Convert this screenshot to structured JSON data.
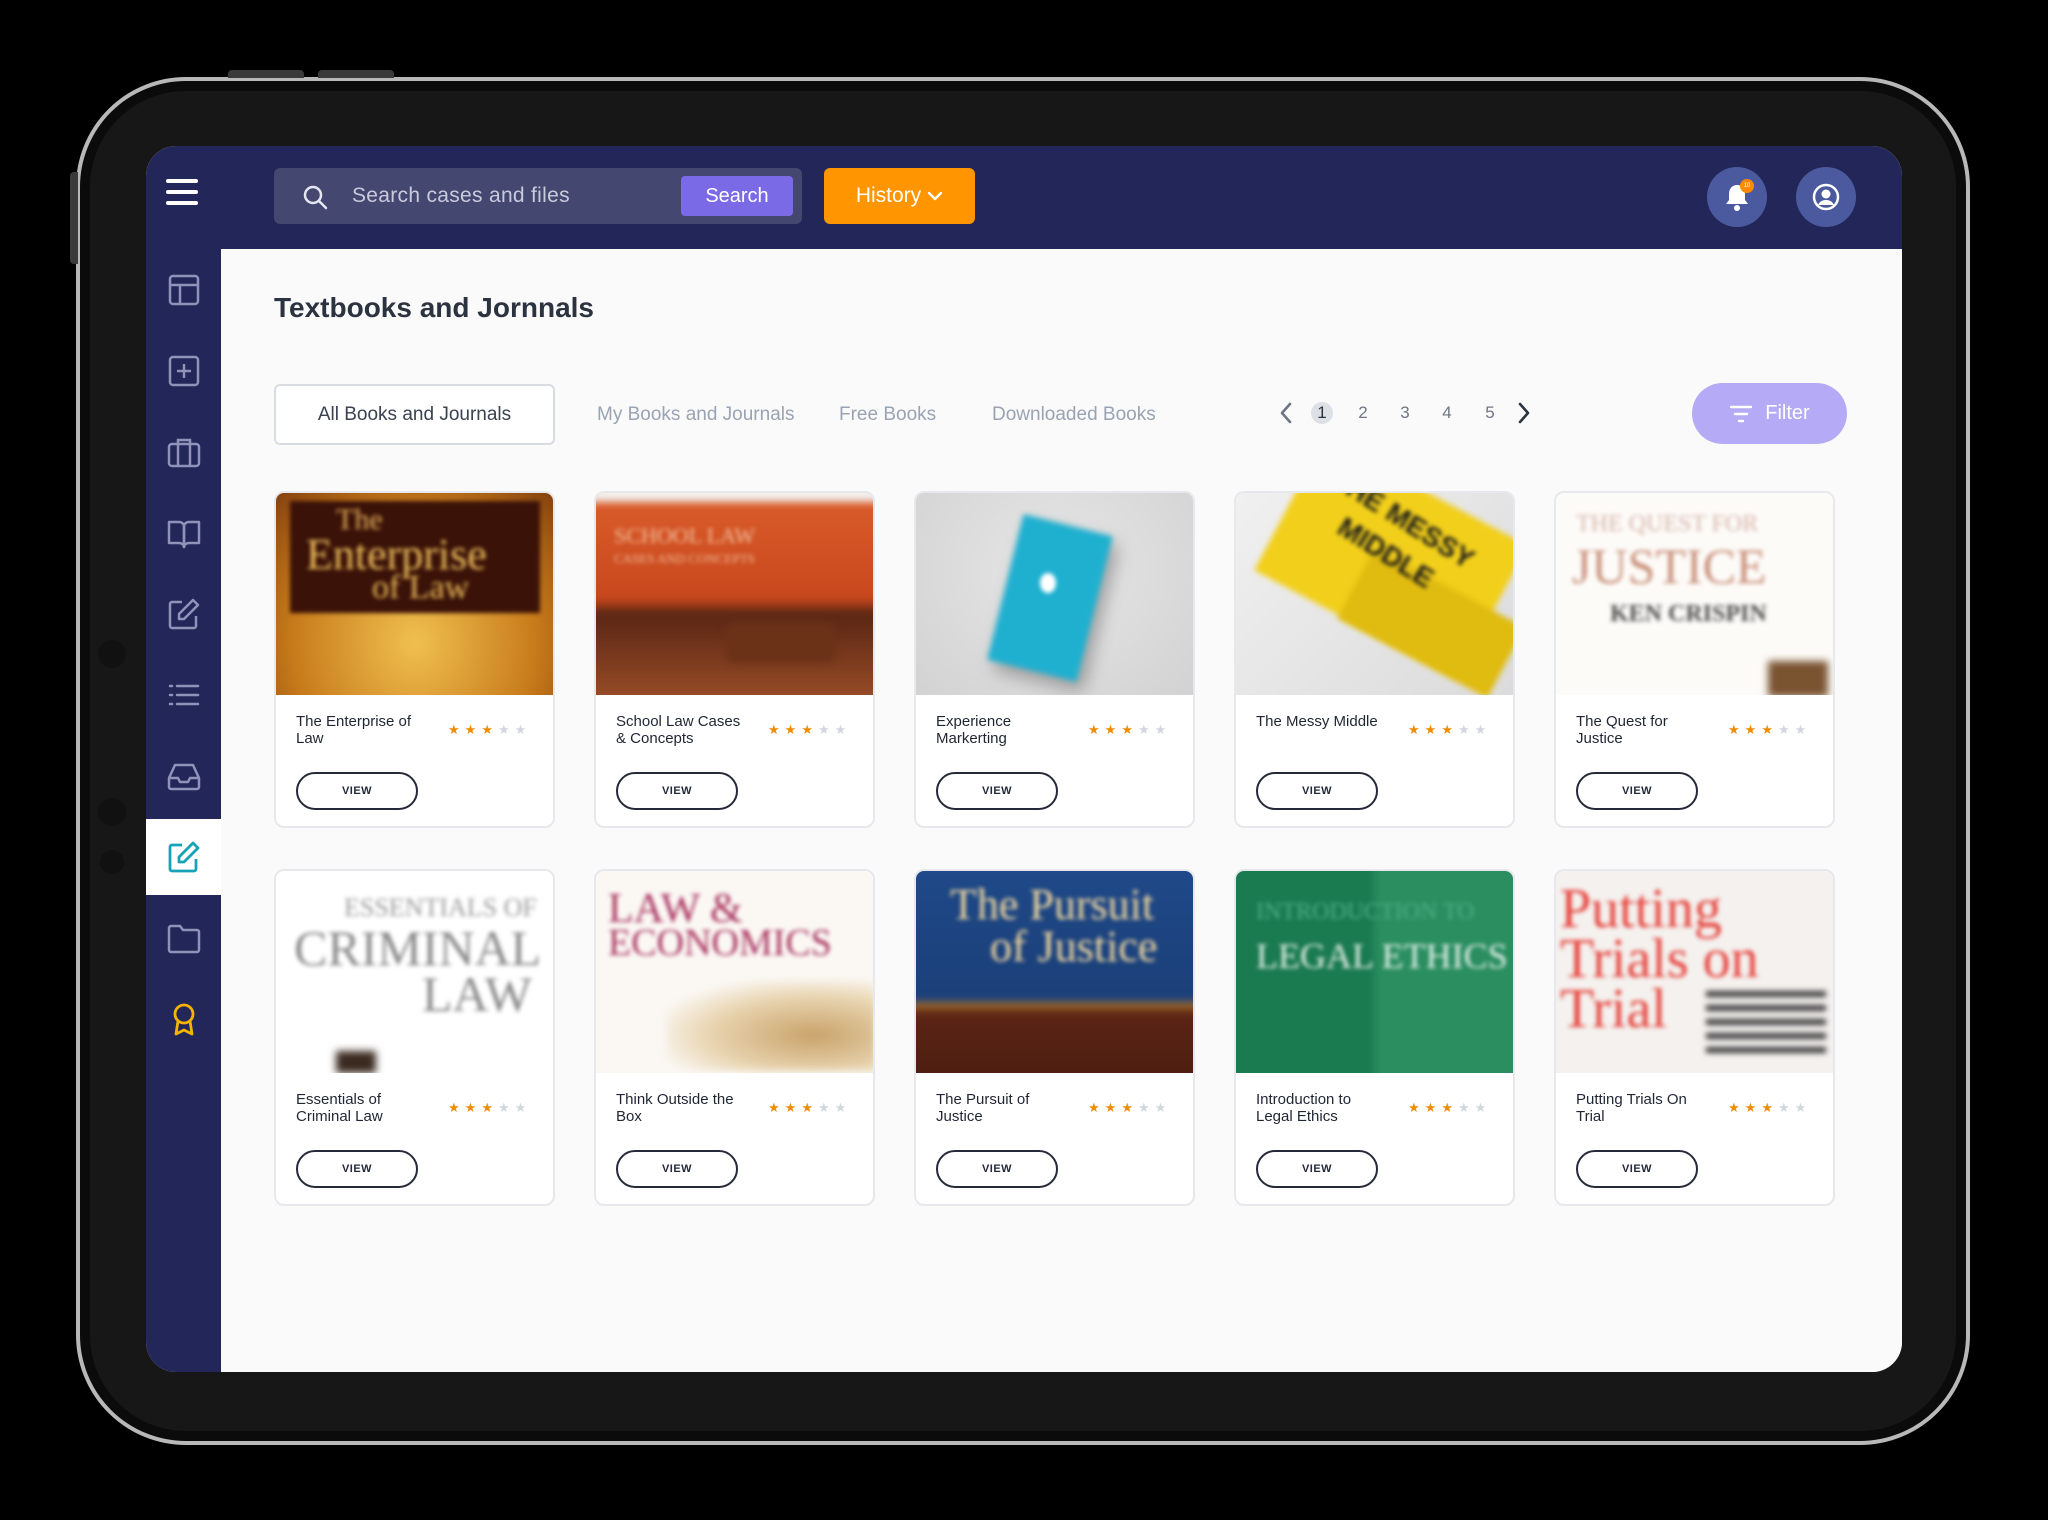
{
  "header": {
    "search_placeholder": "Search cases and files",
    "search_button": "Search",
    "history_label": "History",
    "notification_count": "10"
  },
  "page": {
    "title": "Textbooks and Jornnals"
  },
  "tabs": [
    {
      "label": "All Books and Journals",
      "active": true
    },
    {
      "label": "My Books and Journals",
      "active": false
    },
    {
      "label": "Free Books",
      "active": false
    },
    {
      "label": "Downloaded Books",
      "active": false
    }
  ],
  "pagination": {
    "pages": [
      "1",
      "2",
      "3",
      "4",
      "5"
    ],
    "current": "1"
  },
  "filter_label": "Filter",
  "books": [
    {
      "title": "The Enterprise of Law",
      "rating": 3,
      "view_label": "VIEW",
      "cover_text": [
        "The",
        "Enterprise",
        "of Law"
      ]
    },
    {
      "title": "School Law Cases & Concepts",
      "rating": 3,
      "view_label": "VIEW",
      "cover_text": [
        "SCHOOL LAW",
        "CASES AND CONCEPTS"
      ]
    },
    {
      "title": "Experience Markerting",
      "rating": 3,
      "view_label": "VIEW",
      "cover_text": []
    },
    {
      "title": "The Messy Middle",
      "rating": 3,
      "view_label": "VIEW",
      "cover_text": [
        "THE MESSY",
        "MIDDLE"
      ]
    },
    {
      "title": "The Quest for Justice",
      "rating": 3,
      "view_label": "VIEW",
      "cover_text": [
        "THE QUEST FOR",
        "JUSTICE",
        "KEN CRISPIN"
      ]
    },
    {
      "title": "Essentials of Criminal Law",
      "rating": 3,
      "view_label": "VIEW",
      "cover_text": [
        "ESSENTIALS OF",
        "CRIMINAL",
        "LAW"
      ]
    },
    {
      "title": "Think Outside the Box",
      "rating": 3,
      "view_label": "VIEW",
      "cover_text": [
        "LAW &",
        "ECONOMICS"
      ]
    },
    {
      "title": "The Pursuit of Justice",
      "rating": 3,
      "view_label": "VIEW",
      "cover_text": [
        "The Pursuit",
        "of Justice"
      ]
    },
    {
      "title": "Introduction to Legal Ethics",
      "rating": 3,
      "view_label": "VIEW",
      "cover_text": [
        "INTRODUCTION TO",
        "LEGAL ETHICS"
      ]
    },
    {
      "title": "Putting Trials On Trial",
      "rating": 3,
      "view_label": "VIEW",
      "cover_text": [
        "Putting",
        "Trials on",
        "Trial"
      ]
    }
  ],
  "colors": {
    "nav_bg": "#232659",
    "accent_orange": "#ff9500",
    "accent_purple": "#7a6ae6",
    "active_icon": "#17a2b8",
    "star_on": "#f08c00"
  },
  "sidebar_icons": [
    "dashboard-icon",
    "add-icon",
    "briefcase-icon",
    "book-icon",
    "edit-icon",
    "list-icon",
    "inbox-icon",
    "edit-document-icon",
    "folder-icon",
    "award-icon"
  ]
}
